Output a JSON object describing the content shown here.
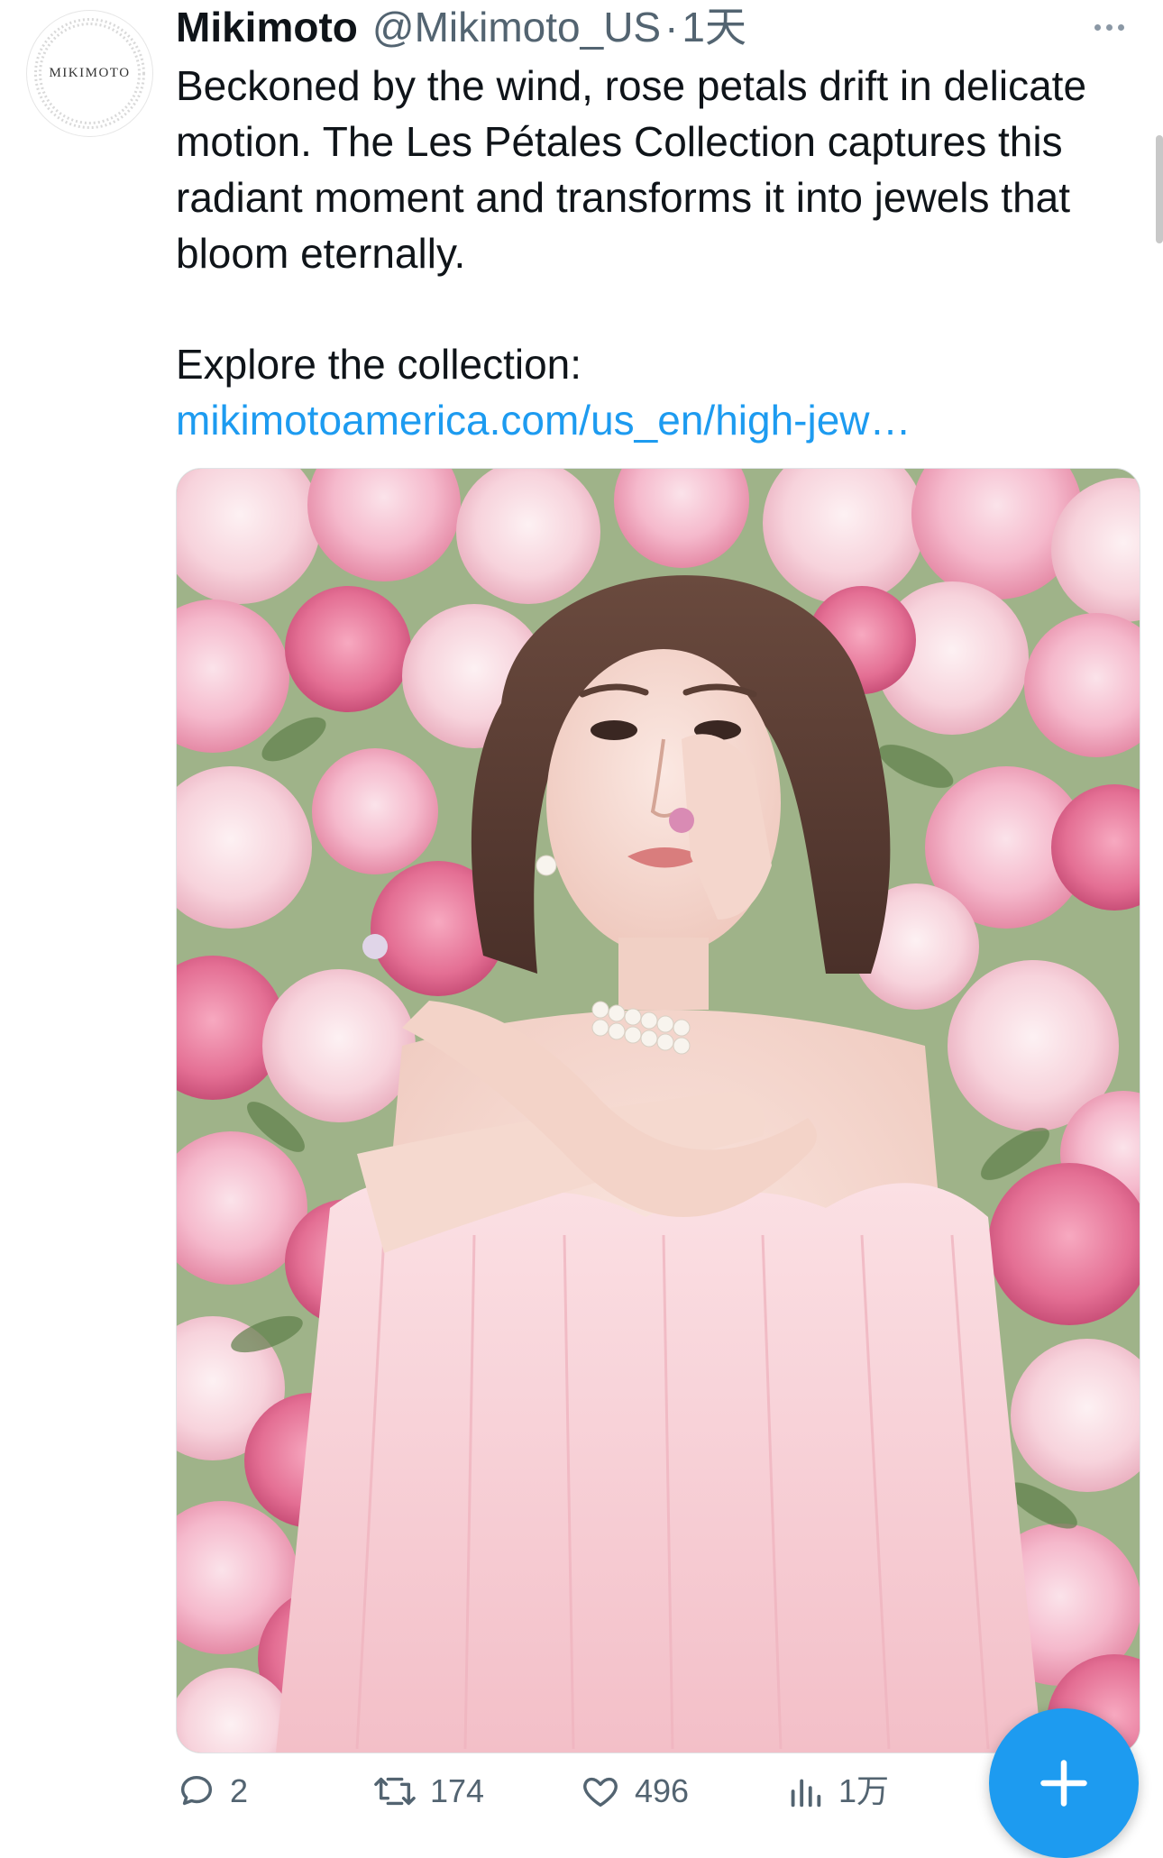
{
  "author": {
    "display_name": "Mikimoto",
    "handle": "@Mikimoto_US",
    "separator": "·",
    "time": "1天",
    "avatar_text": "MIKIMOTO"
  },
  "tweet": {
    "text": "Beckoned by the wind, rose petals drift in delicate motion. The Les Pétales Collection captures this radiant moment and transforms it into jewels that bloom eternally.",
    "explore": "Explore the collection:",
    "link_text": "mikimotoamerica.com/us_en/high-jew…"
  },
  "actions": {
    "reply_count": "2",
    "retweet_count": "174",
    "like_count": "496",
    "views_count": "1万"
  },
  "icons": {
    "more": "more-dots-icon",
    "reply": "reply-bubble-icon",
    "retweet": "retweet-icon",
    "like": "heart-icon",
    "views": "views-bar-chart-icon",
    "compose": "plus-icon"
  },
  "colors": {
    "link": "#1d9bf0",
    "muted": "#536471",
    "fab": "#1d9bf0"
  }
}
